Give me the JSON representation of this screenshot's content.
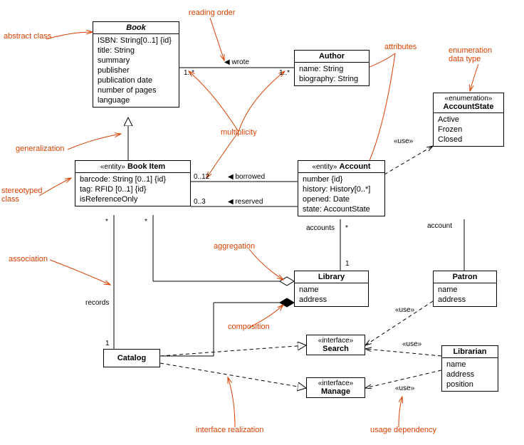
{
  "classes": {
    "book": {
      "name": "Book",
      "attrs": [
        "ISBN: String[0..1] {id}",
        "title: String",
        "summary",
        "publisher",
        "publication date",
        "number of pages",
        "language"
      ]
    },
    "author": {
      "name": "Author",
      "attrs": [
        "name: String",
        "biography: String"
      ]
    },
    "accountState": {
      "stereotype": "«enumeration»",
      "name": "AccountState",
      "attrs": [
        "Active",
        "Frozen",
        "Closed"
      ]
    },
    "bookItem": {
      "stereotype": "«entity»",
      "name": "Book Item",
      "attrs": [
        "barcode: String [0..1] {id}",
        "tag: RFID [0..1] {id}",
        "isReferenceOnly"
      ]
    },
    "account": {
      "stereotype": "«entity»",
      "name": "Account",
      "attrs": [
        "number {id}",
        "history: History[0..*]",
        "opened: Date",
        "state: AccountState"
      ]
    },
    "library": {
      "name": "Library",
      "attrs": [
        "name",
        "address"
      ]
    },
    "patron": {
      "name": "Patron",
      "attrs": [
        "name",
        "address"
      ]
    },
    "librarian": {
      "name": "Librarian",
      "attrs": [
        "name",
        "address",
        "position"
      ]
    },
    "catalog": {
      "name": "Catalog"
    },
    "search": {
      "stereotype": "«interface»",
      "name": "Search"
    },
    "manage": {
      "stereotype": "«interface»",
      "name": "Manage"
    }
  },
  "annotations": {
    "abstractClass": "abstract class",
    "readingOrder": "reading order",
    "attributes": "attributes",
    "enumeration": "enumeration\ndata type",
    "generalization": "generalization",
    "stereotypedClass": "stereotyped\nclass",
    "multiplicity": "multiplicity",
    "aggregation": "aggregation",
    "association": "association",
    "composition": "composition",
    "interfaceRealization": "interface realization",
    "usageDependency": "usage dependency"
  },
  "labels": {
    "wrote": "wrote",
    "borrowed": "borrowed",
    "reserved": "reserved",
    "accounts": "accounts",
    "account": "account",
    "records": "records",
    "use": "«use»",
    "m1star": "1..*",
    "m012": "0..12",
    "m03": "0..3",
    "star": "*",
    "one": "1"
  },
  "chart_data": {
    "type": "uml-class-diagram",
    "classes": [
      {
        "name": "Book",
        "abstract": true,
        "attrs": [
          "ISBN: String[0..1] {id}",
          "title: String",
          "summary",
          "publisher",
          "publication date",
          "number of pages",
          "language"
        ]
      },
      {
        "name": "Author",
        "attrs": [
          "name: String",
          "biography: String"
        ]
      },
      {
        "name": "AccountState",
        "stereotype": "enumeration",
        "literals": [
          "Active",
          "Frozen",
          "Closed"
        ]
      },
      {
        "name": "Book Item",
        "stereotype": "entity",
        "attrs": [
          "barcode: String [0..1] {id}",
          "tag: RFID [0..1] {id}",
          "isReferenceOnly"
        ]
      },
      {
        "name": "Account",
        "stereotype": "entity",
        "attrs": [
          "number {id}",
          "history: History[0..*]",
          "opened: Date",
          "state: AccountState"
        ]
      },
      {
        "name": "Library",
        "attrs": [
          "name",
          "address"
        ]
      },
      {
        "name": "Patron",
        "attrs": [
          "name",
          "address"
        ]
      },
      {
        "name": "Librarian",
        "attrs": [
          "name",
          "address",
          "position"
        ]
      },
      {
        "name": "Catalog"
      },
      {
        "name": "Search",
        "stereotype": "interface"
      },
      {
        "name": "Manage",
        "stereotype": "interface"
      }
    ],
    "relationships": [
      {
        "type": "association",
        "from": "Book",
        "to": "Author",
        "name": "wrote",
        "fromMult": "1..*",
        "toMult": "1..*",
        "readingDirection": "toward Book"
      },
      {
        "type": "generalization",
        "from": "Book Item",
        "to": "Book"
      },
      {
        "type": "association",
        "from": "Book Item",
        "to": "Account",
        "name": "borrowed",
        "fromMult": "0..12",
        "readingDirection": "toward Book Item"
      },
      {
        "type": "association",
        "from": "Book Item",
        "to": "Account",
        "name": "reserved",
        "fromMult": "0..3",
        "readingDirection": "toward Book Item"
      },
      {
        "type": "dependency",
        "stereotype": "use",
        "from": "Account",
        "to": "AccountState"
      },
      {
        "type": "aggregation",
        "whole": "Library",
        "part": "Account",
        "partRole": "accounts",
        "partMult": "*"
      },
      {
        "type": "aggregation",
        "whole": "Library",
        "part": "Book Item",
        "partMult": "*"
      },
      {
        "type": "composition",
        "whole": "Library",
        "part": "Catalog"
      },
      {
        "type": "association",
        "from": "Catalog",
        "to": "Book Item",
        "name": "records",
        "fromMult": "1",
        "toMult": "*"
      },
      {
        "type": "aggregation",
        "whole": "Patron",
        "part": "Account",
        "partRole": "account"
      },
      {
        "type": "realization",
        "from": "Catalog",
        "to": "Search"
      },
      {
        "type": "realization",
        "from": "Catalog",
        "to": "Manage"
      },
      {
        "type": "dependency",
        "stereotype": "use",
        "from": "Patron",
        "to": "Search"
      },
      {
        "type": "dependency",
        "stereotype": "use",
        "from": "Librarian",
        "to": "Search"
      },
      {
        "type": "dependency",
        "stereotype": "use",
        "from": "Librarian",
        "to": "Manage"
      }
    ],
    "annotations": [
      "abstract class",
      "reading order",
      "attributes",
      "enumeration data type",
      "generalization",
      "stereotyped class",
      "multiplicity",
      "aggregation",
      "association",
      "composition",
      "interface realization",
      "usage dependency"
    ]
  }
}
